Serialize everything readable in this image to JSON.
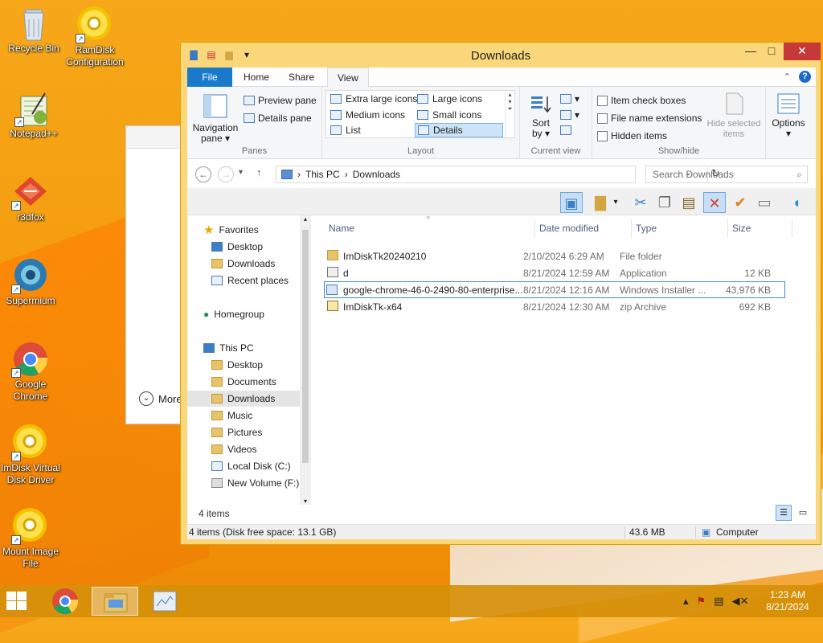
{
  "desktop": {
    "icons": [
      {
        "label": "Recycle Bin"
      },
      {
        "label": "RamDisk\nConfiguration"
      },
      {
        "label": "Notepad++"
      },
      {
        "label": "r3dfox"
      },
      {
        "label": "Supermium"
      },
      {
        "label": "Google\nChrome"
      },
      {
        "label": "ImDisk Virtual\nDisk Driver"
      },
      {
        "label": "Mount Image\nFile"
      }
    ],
    "background_window_more_label": "More"
  },
  "window": {
    "title": "Downloads",
    "controls": {
      "minimize": "—",
      "maximize": "□",
      "close": "✕"
    },
    "tabs": [
      {
        "label": "File"
      },
      {
        "label": "Home"
      },
      {
        "label": "Share"
      },
      {
        "label": "View"
      }
    ],
    "ribbon": {
      "panes": {
        "group_label": "Panes",
        "navigation_pane": "Navigation\npane ▾",
        "preview_pane": "Preview pane",
        "details_pane": "Details pane"
      },
      "layout": {
        "group_label": "Layout",
        "items": [
          "Extra large icons",
          "Large icons",
          "Medium icons",
          "Small icons",
          "List",
          "Details"
        ],
        "selected": "Details"
      },
      "current_view": {
        "group_label": "Current view",
        "sort_by": "Sort\nby ▾"
      },
      "show_hide": {
        "group_label": "Show/hide",
        "item_check_boxes": "Item check boxes",
        "file_name_extensions": "File name extensions",
        "hidden_items": "Hidden items",
        "hide_selected_items": "Hide selected\nitems"
      },
      "options": {
        "label": "Options\n▾"
      }
    },
    "address": {
      "path": [
        "This PC",
        "Downloads"
      ],
      "search_placeholder": "Search Downloads"
    },
    "nav_pane": {
      "favorites": {
        "label": "Favorites",
        "items": [
          "Desktop",
          "Downloads",
          "Recent places"
        ]
      },
      "homegroup": "Homegroup",
      "this_pc": {
        "label": "This PC",
        "items": [
          "Desktop",
          "Documents",
          "Downloads",
          "Music",
          "Pictures",
          "Videos",
          "Local Disk (C:)",
          "New Volume (F:)"
        ]
      },
      "selected": "Downloads"
    },
    "columns": {
      "name": "Name",
      "date": "Date modified",
      "type": "Type",
      "size": "Size"
    },
    "files": [
      {
        "name": "ImDiskTk20240210",
        "date": "2/10/2024 6:29 AM",
        "type": "File folder",
        "size": ""
      },
      {
        "name": "d",
        "date": "8/21/2024 12:59 AM",
        "type": "Application",
        "size": "12 KB"
      },
      {
        "name": "google-chrome-46-0-2490-80-enterprise...",
        "date": "8/21/2024 12:16 AM",
        "type": "Windows Installer ...",
        "size": "43,976 KB"
      },
      {
        "name": "ImDiskTk-x64",
        "date": "8/21/2024 12:30 AM",
        "type": "zip Archive",
        "size": "692 KB"
      }
    ],
    "item_count": "4 items",
    "status": {
      "left": "4 items (Disk free space: 13.1 GB)",
      "size": "43.6 MB",
      "location": "Computer"
    }
  },
  "taskbar": {
    "time": "1:23 AM",
    "date": "8/21/2024"
  },
  "colors": {
    "desktop": "#f49a0c",
    "window_frame": "#f9d77a",
    "file_tab": "#1979ca",
    "close_button": "#c7383a"
  }
}
